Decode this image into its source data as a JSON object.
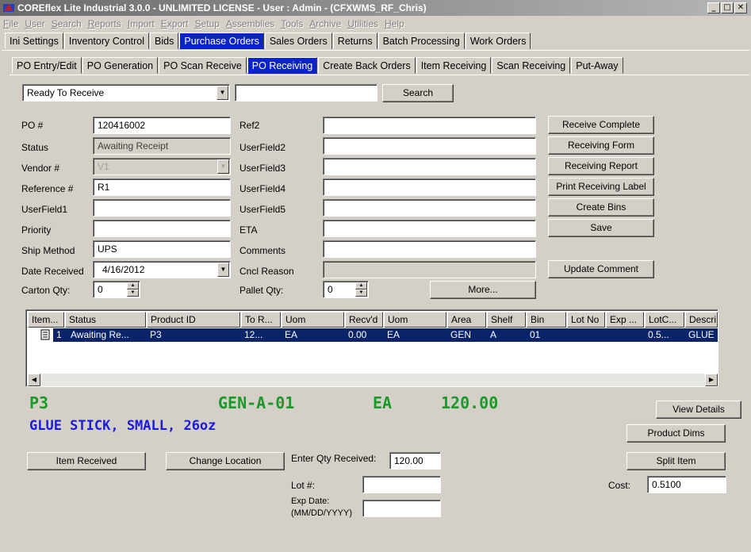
{
  "window": {
    "title": "COREflex Lite Industrial 3.0.0 - UNLIMITED LICENSE - User : Admin - (CFXWMS_RF_Chris)",
    "min": "_",
    "max": "□",
    "close": "✕"
  },
  "menu": [
    "File",
    "User",
    "Search",
    "Reports",
    "Import",
    "Export",
    "Setup",
    "Assemblies",
    "Tools",
    "Archive",
    "Utilities",
    "Help"
  ],
  "main_tabs": [
    "Ini Settings",
    "Inventory Control",
    "Bids",
    "Purchase Orders",
    "Sales Orders",
    "Returns",
    "Batch Processing",
    "Work Orders"
  ],
  "main_tab_active": "Purchase Orders",
  "sub_tabs": [
    "PO Entry/Edit",
    "PO Generation",
    "PO Scan Receive",
    "PO Receiving",
    "Create Back Orders",
    "Item Receiving",
    "Scan Receiving",
    "Put-Away"
  ],
  "sub_tab_active": "PO Receiving",
  "filter": {
    "status": "Ready To Receive",
    "search_text": "",
    "search_label": "Search"
  },
  "form": {
    "po_label": "PO #",
    "po_value": "120416002",
    "status_label": "Status",
    "status_value": "Awaiting Receipt",
    "vendor_label": "Vendor #",
    "vendor_value": "V1",
    "reference_label": "Reference #",
    "reference_value": "R1",
    "userfield1_label": "UserField1",
    "userfield1_value": "",
    "priority_label": "Priority",
    "priority_value": "",
    "ship_label": "Ship Method",
    "ship_value": "UPS",
    "date_label": "Date Received",
    "date_value": "4/16/2012",
    "carton_label": "Carton Qty:",
    "carton_value": "0",
    "ref2_label": "Ref2",
    "ref2_value": "",
    "userfield2_label": "UserField2",
    "userfield2_value": "",
    "userfield3_label": "UserField3",
    "userfield3_value": "",
    "userfield4_label": "UserField4",
    "userfield4_value": "",
    "userfield5_label": "UserField5",
    "userfield5_value": "",
    "eta_label": "ETA",
    "eta_value": "",
    "comments_label": "Comments",
    "comments_value": "",
    "cncl_label": "Cncl Reason",
    "cncl_value": "",
    "pallet_label": "Pallet Qty:",
    "pallet_value": "0",
    "more_label": "More..."
  },
  "actions": {
    "receive_complete": "Receive Complete",
    "receiving_form": "Receiving Form",
    "receiving_report": "Receiving Report",
    "print_label": "Print Receiving Label",
    "create_bins": "Create Bins",
    "save": "Save",
    "update_comment": "Update Comment"
  },
  "grid": {
    "columns": [
      "Item...",
      "Status",
      "Product ID",
      "To R...",
      "Uom",
      "Recv'd",
      "Uom",
      "Area",
      "Shelf",
      "Bin",
      "Lot No",
      "Exp ...",
      "LotC...",
      "Descri"
    ],
    "rows": [
      [
        "1",
        "Awaiting Re...",
        "P3",
        "12...",
        "EA",
        "0.00",
        "EA",
        "GEN",
        "A",
        "01",
        "",
        "",
        "0.5...",
        "GLUE"
      ]
    ],
    "scroll_left": "◀",
    "scroll_right": "▶"
  },
  "detail": {
    "product": "P3",
    "location": "GEN-A-01",
    "uom": "EA",
    "qty": "120.00",
    "description": "GLUE STICK, SMALL, 26oz"
  },
  "bottom": {
    "view_details": "View Details",
    "product_dims": "Product Dims",
    "split_item": "Split Item",
    "item_received": "Item Received",
    "change_location": "Change Location",
    "enter_qty_label": "Enter Qty Received:",
    "enter_qty_value": "120.00",
    "lot_label": "Lot #:",
    "lot_value": "",
    "exp_label": "Exp Date:",
    "exp_format": "(MM/DD/YYYY)",
    "exp_value": "",
    "cost_label": "Cost:",
    "cost_value": "0.5100"
  },
  "colors": {
    "accent": "#0a24c8",
    "selection": "#0a246a",
    "green_text": "#1a9a2a",
    "blue_text": "#1a1ae0"
  }
}
